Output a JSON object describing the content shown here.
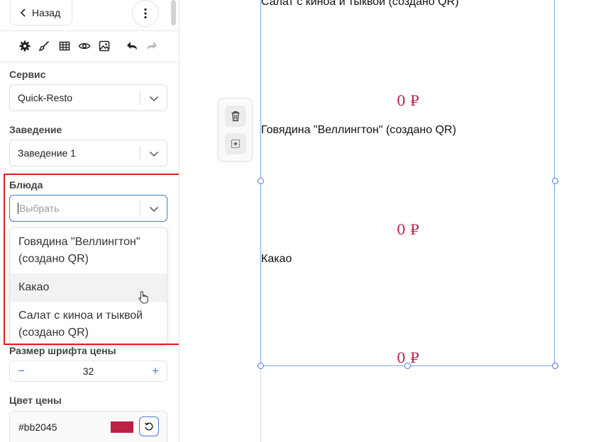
{
  "sidebar": {
    "back_label": "Назад",
    "fields": {
      "service_label": "Сервис",
      "service_value": "Quick-Resto",
      "venue_label": "Заведение",
      "venue_value": "Заведение 1",
      "dishes_label": "Блюда",
      "dishes_placeholder": "Выбрать"
    },
    "dropdown_options": [
      "Говядина \"Веллингтон\" (создано QR)",
      "Какао",
      "Салат с киноа и тыквой (создано QR)"
    ],
    "font_size_label": "Размер шрифта цены",
    "font_size_value": "32",
    "stepper_minus": "−",
    "stepper_plus": "+",
    "price_color_label": "Цвет цены",
    "price_color_value": "#bb2045"
  },
  "toolbar_icons": [
    "gear-icon",
    "brush-icon",
    "table-icon",
    "eye-icon",
    "image-icon",
    "undo-icon",
    "redo-icon"
  ],
  "canvas": {
    "dishes": [
      {
        "name": "Салат с киноа и тыквой (создано QR)",
        "price": "0 ₽"
      },
      {
        "name": "Говядина \"Веллингтон\" (создано QR)",
        "price": "0 ₽"
      },
      {
        "name": "Какао",
        "price": "0 ₽"
      }
    ]
  },
  "colors": {
    "accent": "#4a77d9",
    "price": "#bb2045",
    "highlight": "#e41b1b"
  }
}
